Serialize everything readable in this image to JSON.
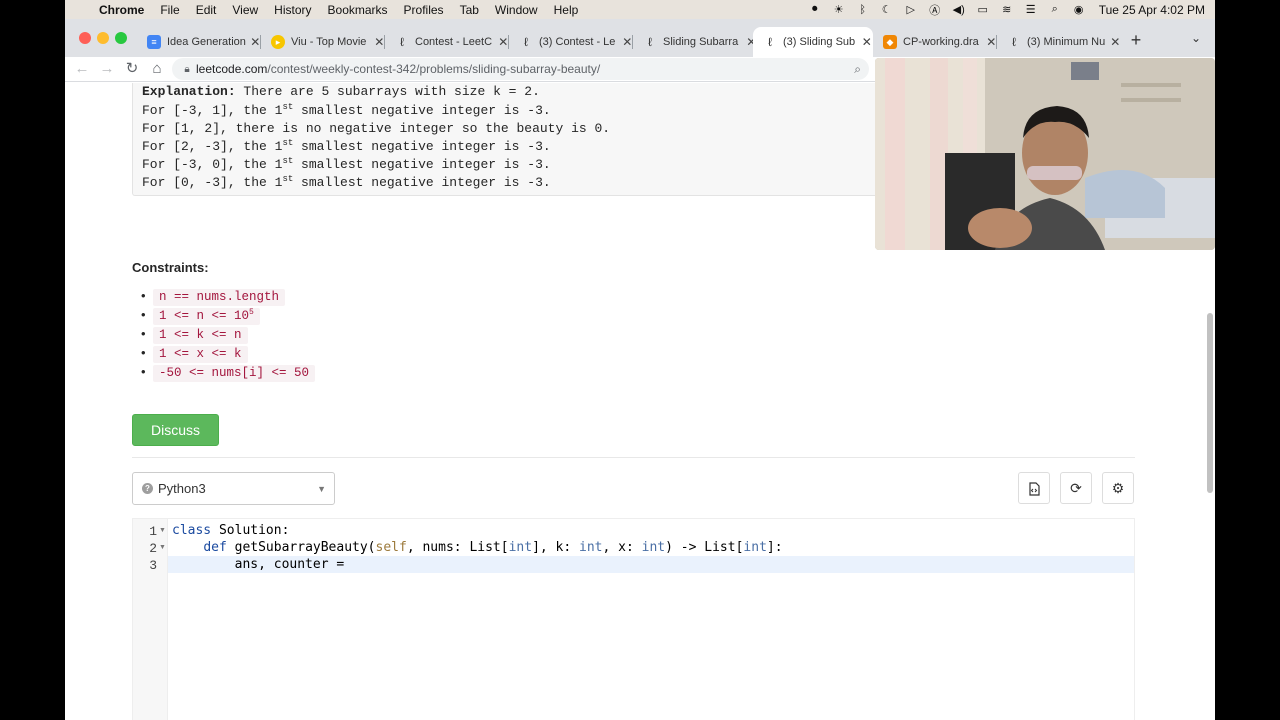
{
  "menubar": {
    "app": "Chrome",
    "menus": [
      "File",
      "Edit",
      "View",
      "History",
      "Bookmarks",
      "Profiles",
      "Tab",
      "Window",
      "Help"
    ],
    "clock": "Tue 25 Apr  4:02 PM"
  },
  "tabs": [
    {
      "title": "Idea Generation",
      "icon": "docs-icon",
      "color": "#4285f4"
    },
    {
      "title": "Viu - Top Movie",
      "icon": "viu-icon",
      "color": "#f7c600"
    },
    {
      "title": "Contest - LeetC",
      "icon": "leetcode-icon",
      "color": "#333333"
    },
    {
      "title": "(3) Contest - Le",
      "icon": "leetcode-icon",
      "color": "#333333"
    },
    {
      "title": "Sliding Subarra",
      "icon": "leetcode-icon",
      "color": "#333333"
    },
    {
      "title": "(3) Sliding Sub",
      "icon": "leetcode-icon",
      "color": "#333333",
      "active": true
    },
    {
      "title": "CP-working.dra",
      "icon": "drawio-icon",
      "color": "#f08705"
    },
    {
      "title": "(3) Minimum Nu",
      "icon": "leetcode-icon",
      "color": "#333333"
    }
  ],
  "address": {
    "host": "leetcode.com",
    "path": "/contest/weekly-contest-342/problems/sliding-subarray-beauty/"
  },
  "explanation": {
    "label": "Explanation:",
    "text": " There are 5 subarrays with size k = 2.",
    "lines": [
      {
        "pre": "For [-3, 1], the 1",
        "sup": "st",
        "post": " smallest negative integer is -3."
      },
      {
        "pre": "For [1, 2], there is no negative integer so the beauty is 0.",
        "sup": "",
        "post": ""
      },
      {
        "pre": "For [2, -3], the 1",
        "sup": "st",
        "post": " smallest negative integer is -3."
      },
      {
        "pre": "For [-3, 0], the 1",
        "sup": "st",
        "post": " smallest negative integer is -3."
      },
      {
        "pre": "For [0, -3], the 1",
        "sup": "st",
        "post": " smallest negative integer is -3."
      }
    ]
  },
  "constraints": {
    "title": "Constraints:",
    "items": [
      {
        "text": "n == nums.length",
        "sup": ""
      },
      {
        "text": "1 <= n <= 10",
        "sup": "5"
      },
      {
        "text": "1 <= k <= n",
        "sup": ""
      },
      {
        "text": "1 <= x <= k",
        "sup": ""
      },
      {
        "text": "-50 <= nums[i] <= 50",
        "sup": ""
      }
    ]
  },
  "discuss_label": "Discuss",
  "language": "Python3",
  "code": {
    "line_numbers": [
      "1",
      "2",
      "3"
    ],
    "line1": {
      "kw": "class",
      "rest": " Solution:"
    },
    "line2": {
      "indent": "    ",
      "kw": "def",
      "name": " getSubarrayBeauty(",
      "self": "self",
      "p1": ", nums: List[",
      "t1": "int",
      "p2": "], k: ",
      "t2": "int",
      "p3": ", x: ",
      "t3": "int",
      "p4": ") -> List[",
      "t4": "int",
      "p5": "]:"
    },
    "line3": "        ans, counter ="
  },
  "colors": {
    "discuss": "#5cb85c",
    "code_keyword": "#1c4ba0",
    "constraint_code": "#a3153d"
  }
}
